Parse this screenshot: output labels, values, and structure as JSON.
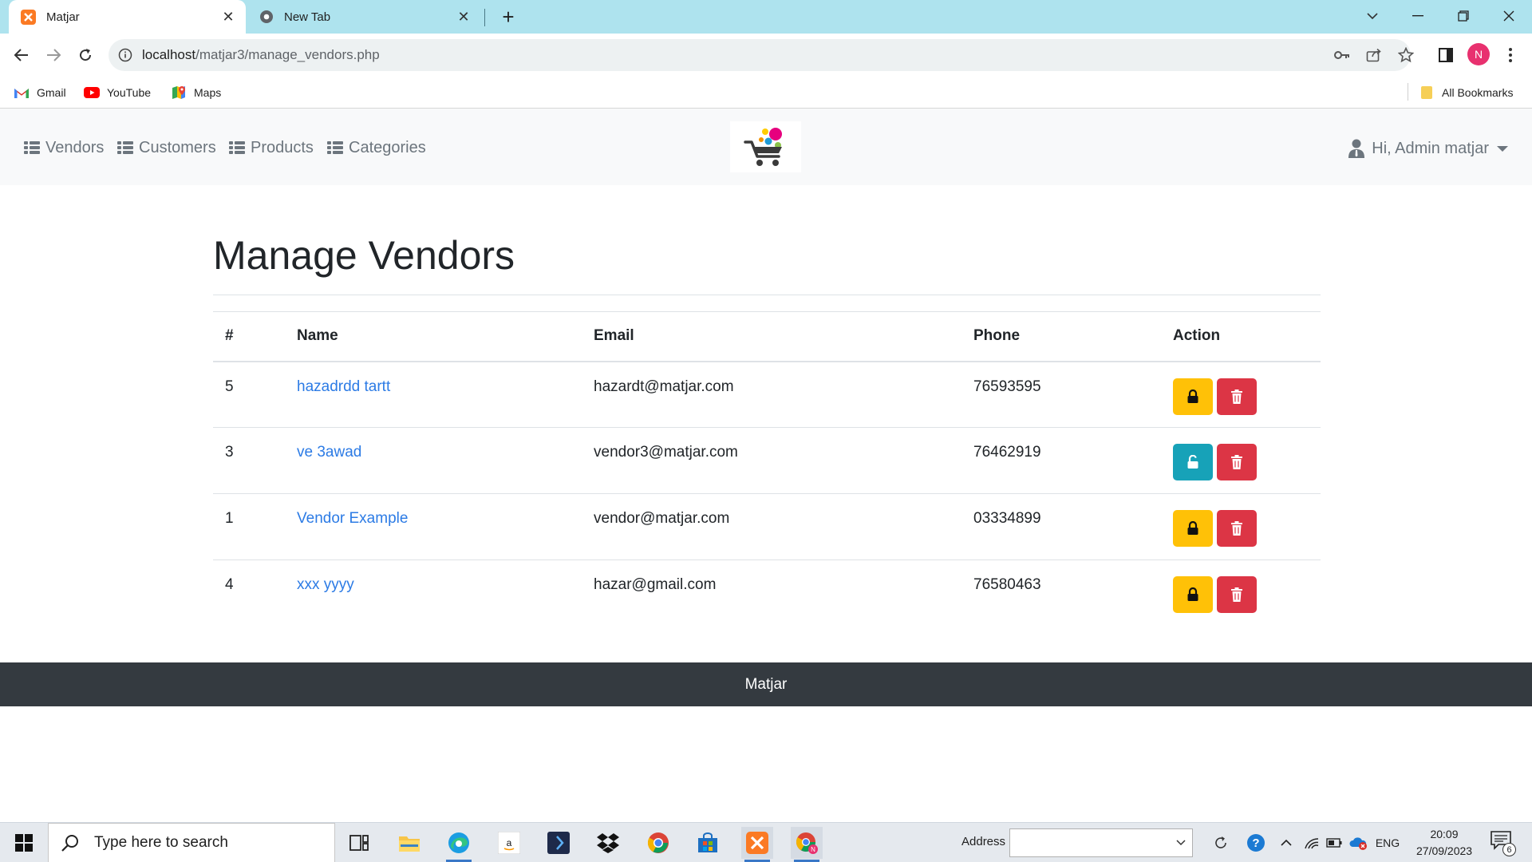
{
  "browser": {
    "tabs": [
      {
        "title": "Matjar",
        "active": true
      },
      {
        "title": "New Tab",
        "active": false
      }
    ],
    "url_host": "localhost",
    "url_path": "/matjar3/manage_vendors.php",
    "profile_initial": "N",
    "bookmarks": [
      {
        "label": "Gmail",
        "icon": "gmail-icon"
      },
      {
        "label": "YouTube",
        "icon": "youtube-icon"
      },
      {
        "label": "Maps",
        "icon": "maps-icon"
      }
    ],
    "all_bookmarks_label": "All Bookmarks"
  },
  "navbar": {
    "links": [
      {
        "label": "Vendors"
      },
      {
        "label": "Customers"
      },
      {
        "label": "Products"
      },
      {
        "label": "Categories"
      }
    ],
    "user_label": "Hi, Admin matjar"
  },
  "main": {
    "title": "Manage Vendors",
    "columns": [
      "#",
      "Name",
      "Email",
      "Phone",
      "Action"
    ],
    "rows": [
      {
        "id": "5",
        "name": "hazadrdd tartt",
        "email": "hazardt@matjar.com",
        "phone": "76593595",
        "lock_state": "locked"
      },
      {
        "id": "3",
        "name": "ve 3awad",
        "email": "vendor3@matjar.com",
        "phone": "76462919",
        "lock_state": "unlocked"
      },
      {
        "id": "1",
        "name": "Vendor Example",
        "email": "vendor@matjar.com",
        "phone": "03334899",
        "lock_state": "locked"
      },
      {
        "id": "4",
        "name": "xxx yyyy",
        "email": "hazar@gmail.com",
        "phone": "76580463",
        "lock_state": "locked"
      }
    ]
  },
  "footer": {
    "text": "Matjar"
  },
  "taskbar": {
    "search_placeholder": "Type here to search",
    "address_label": "Address",
    "language": "ENG",
    "time": "20:09",
    "date": "27/09/2023",
    "notification_count": "6"
  },
  "colors": {
    "tab_strip": "#aee3ee",
    "link": "#2c7be5",
    "lock_button": "#ffc107",
    "unlock_button": "#17a2b8",
    "delete_button": "#dc3545",
    "footer": "#343a40"
  }
}
